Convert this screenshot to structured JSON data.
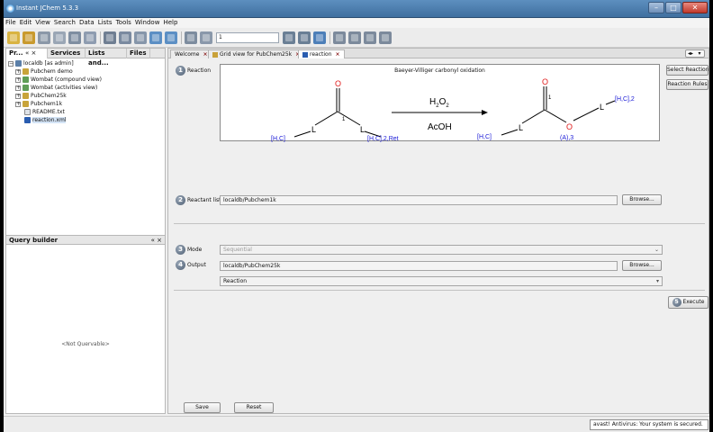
{
  "window": {
    "title": "Instant JChem 5.3.3"
  },
  "menu": [
    "File",
    "Edit",
    "View",
    "Search",
    "Data",
    "Lists",
    "Tools",
    "Window",
    "Help"
  ],
  "toolbar": {
    "icons": [
      "new-icon",
      "open-icon",
      "print-icon",
      "print-preview-icon",
      "export-icon",
      "import-icon",
      "cut-icon",
      "copy-icon",
      "paste-icon",
      "undo-icon",
      "redo-icon",
      "sort-icon",
      "eject-icon",
      "filter-icon",
      "clear-filter-icon",
      "chart-icon",
      "sort-asc-icon",
      "sort-desc-icon",
      "sort-multi-icon",
      "sort-clear-icon"
    ],
    "combo_value": "1"
  },
  "left_tabs": [
    "Pr...",
    "Services",
    "Lists and...",
    "Files"
  ],
  "tree": [
    {
      "label": "localdb [as admin]",
      "level": 0,
      "expanded": true,
      "icon": "database-icon"
    },
    {
      "label": "Pubchem demo",
      "level": 1,
      "expanded": false,
      "icon": "schema-icon"
    },
    {
      "label": "Wombat (compound view)",
      "level": 1,
      "expanded": false,
      "icon": "table-icon"
    },
    {
      "label": "Wombat (activities view)",
      "level": 1,
      "expanded": false,
      "icon": "table-icon"
    },
    {
      "label": "PubChem25k",
      "level": 1,
      "expanded": false,
      "icon": "schema-icon"
    },
    {
      "label": "Pubchem1k",
      "level": 1,
      "expanded": false,
      "icon": "schema-icon"
    },
    {
      "label": "README.txt",
      "level": 1,
      "expanded": null,
      "icon": "file-icon"
    },
    {
      "label": "reaction.xml",
      "level": 1,
      "expanded": null,
      "icon": "reaction-file-icon",
      "selected": true
    }
  ],
  "query_builder": {
    "title": "Query builder",
    "placeholder": "<Not Quervable>"
  },
  "editor_tabs": [
    {
      "label": "Welcome",
      "active": false
    },
    {
      "label": "Grid view for PubChem25k",
      "active": false
    },
    {
      "label": "reaction",
      "active": true
    }
  ],
  "reaction": {
    "step": "1",
    "label": "Reaction",
    "title": "Baeyer-Villiger carbonyl oxidation",
    "reagent_top": "H2O2",
    "reagent_bottom": "AcOH",
    "reactant": {
      "o": "O",
      "l_left": "L",
      "l_right": "L",
      "num": "1",
      "hc_left": "[H,C]",
      "hc_right": "[H,C],2,Ret"
    },
    "product": {
      "o": "O",
      "o2": "O",
      "l_left": "L",
      "l_right": "L",
      "num": "1",
      "hc_left": "[H,C]",
      "hc_right": "[H,C],2",
      "a3": "(A),3"
    }
  },
  "side_buttons": {
    "select_reaction": "Select Reaction",
    "reaction_rules": "Reaction Rules"
  },
  "reactant_list": {
    "step": "2",
    "label": "Reactant list",
    "value": "localdb/Pubchem1k",
    "browse": "Browse..."
  },
  "mode": {
    "step": "3",
    "label": "Mode",
    "value": "Sequential"
  },
  "output": {
    "step": "4",
    "label": "Output",
    "value": "localdb/PubChem25k",
    "browse": "Browse...",
    "type_value": "Reaction"
  },
  "execute": {
    "step": "5",
    "label": "Execute"
  },
  "bottom_buttons": {
    "save": "Save",
    "reset": "Reset"
  },
  "status": {
    "message": "avast! Antivirus: Your system is secured."
  },
  "colors": {
    "blue_atoms": "#1a1ad6",
    "oxygen": "#e01a1a",
    "titlebar": "#4a7bab"
  }
}
